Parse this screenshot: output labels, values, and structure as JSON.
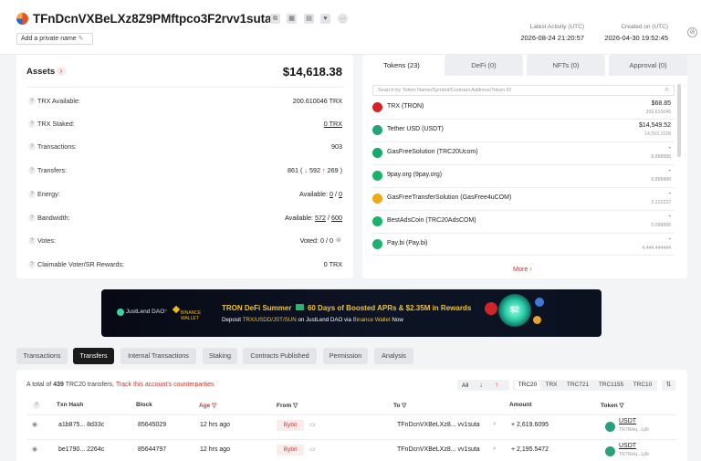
{
  "header": {
    "address": "TFnDcnVXBeLXz8Z9PMftpco3F2rvv1suta",
    "private_name_label": "Add a private name",
    "latest_activity_label": "Latest Activity (UTC)",
    "latest_activity_value": "2026-08-24 21:20:57",
    "created_on_label": "Created on (UTC)",
    "created_on_value": "2026-04-30 19:52:45"
  },
  "assets": {
    "title": "Assets",
    "total": "$14,618.38",
    "rows": [
      {
        "label": "TRX Available:",
        "value": "200.610046 TRX"
      },
      {
        "label": "TRX Staked:",
        "value": "0 TRX"
      },
      {
        "label": "Transactions:",
        "value": "903"
      },
      {
        "label": "Transfers:",
        "total": "861",
        "in": "592",
        "out": "269"
      },
      {
        "label": "Energy:",
        "prefix": "Available:",
        "a": "0",
        "b": "0"
      },
      {
        "label": "Bandwidth:",
        "prefix": "Available:",
        "a": "572",
        "b": "600"
      },
      {
        "label": "Votes:",
        "value": "Voted: 0 / 0"
      },
      {
        "label": "Claimable Voter/SR Rewards:",
        "value": "0 TRX"
      }
    ]
  },
  "token_tabs": [
    "Tokens (23)",
    "DeFi (0)",
    "NFTs (0)",
    "Approval (0)"
  ],
  "token_search_placeholder": "Search by Token Name/Symbol/Contract Address/Token ID",
  "tokens": [
    {
      "name": "TRX (TRON)",
      "value": "$68.85",
      "sub": "200.610046",
      "color": "#d6242a"
    },
    {
      "name": "Tether USD (USDT)",
      "value": "$14,549.52",
      "sub": "14,553.1528",
      "color": "#26a17b"
    },
    {
      "name": "GasFreeSolution (TRC20Ucom)",
      "value": "-",
      "sub": "8.888888",
      "color": "#17a96b"
    },
    {
      "name": "9pay.org (9pay.org)",
      "value": "-",
      "sub": "8.888888",
      "color": "#1bb36a"
    },
    {
      "name": "GasFreeTransferSolution (GasFree4uCOM)",
      "value": "-",
      "sub": "2.222222",
      "color": "#f0a818"
    },
    {
      "name": "BestAdsCoin (TRC20AdsCOM)",
      "value": "-",
      "sub": "0.088888",
      "color": "#1bb36a"
    },
    {
      "name": "Pay.bi (Pay.bi)",
      "value": "-",
      "sub": "4,444.444444",
      "color": "#1bb36a"
    }
  ],
  "more_label": "More",
  "banner": {
    "brand": "JustLend DAO",
    "partner": "BINANCE WALLET",
    "headline_a": "TRON DeFi Summer",
    "headline_b": "60 Days of Boosted APRs & ",
    "headline_c": "$2.35M",
    "headline_d": " in Rewards",
    "sub_a": "Deposit ",
    "sub_b": "TRX/USDD/JST/SUN",
    "sub_c": " on JustLend DAO via ",
    "sub_d": "Binance Wallet",
    "sub_e": " Now",
    "coin_label": "$2"
  },
  "section_tabs": [
    "Transactions",
    "Transfers",
    "Internal Transactions",
    "Staking",
    "Contracts Published",
    "Permission",
    "Analysis"
  ],
  "transfers": {
    "summary_prefix": "A total of ",
    "summary_count": "439",
    "summary_mid": " TRC20 transfers, ",
    "summary_link": "Track this account's counterparties",
    "filter_all": "All",
    "standards": [
      "TRC20",
      "TRX",
      "TRC721",
      "TRC1155",
      "TRC10"
    ],
    "columns": [
      "Txn Hash",
      "Block",
      "Age",
      "From",
      "To",
      "Amount",
      "Token"
    ],
    "rows": [
      {
        "hash": "a1b875... 8d33c",
        "block": "85645029",
        "age": "12 hrs ago",
        "from": "Bybit",
        "to_a": "TFnDcnVXBeLXz8...",
        "to_b": "vv1suta",
        "amount": "+ 2,619.6095",
        "token": "USDT",
        "token_sub": "TR7NHq...Lj6t"
      },
      {
        "hash": "be1790... 2264c",
        "block": "85644797",
        "age": "12 hrs ago",
        "from": "Bybit",
        "to_a": "TFnDcnVXBeLXz8...",
        "to_b": "vv1suta",
        "amount": "+ 2,195.5472",
        "token": "USDT",
        "token_sub": "TR7NHq...Lj6t"
      }
    ]
  }
}
